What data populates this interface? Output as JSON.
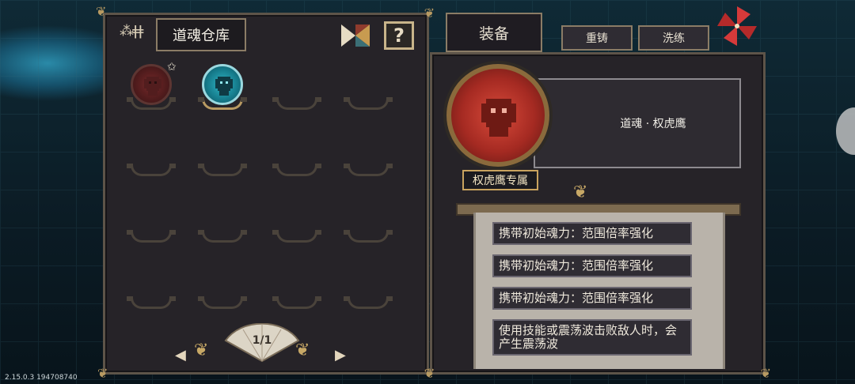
{
  "warehouse": {
    "title": "道魂仓库",
    "help_label": "?",
    "page_indicator": "1/1",
    "prev_arrow": "◀",
    "next_arrow": "▶"
  },
  "tabs": {
    "equip": "装备",
    "reforge": "重铸",
    "wash": "洗练"
  },
  "detail": {
    "name": "道魂 · 权虎鹰",
    "exclusive": "权虎鹰专属",
    "attributes": [
      "携带初始魂力：范围倍率强化",
      "携带初始魂力：范围倍率强化",
      "携带初始魂力：范围倍率强化",
      "使用技能或震荡波击败敌人时，会产生震荡波"
    ]
  },
  "colors": {
    "panel": "#262328",
    "border": "#5d5449",
    "red_orb": "#a52a22",
    "teal_orb": "#157a8a",
    "gold": "#c9a35e"
  },
  "version": "2.15.0.3 194708740"
}
